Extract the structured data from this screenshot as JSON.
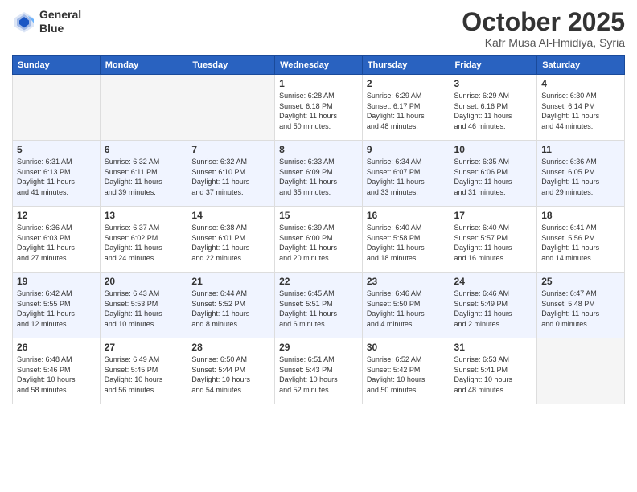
{
  "header": {
    "logo_line1": "General",
    "logo_line2": "Blue",
    "month": "October 2025",
    "location": "Kafr Musa Al-Hmidiya, Syria"
  },
  "days_of_week": [
    "Sunday",
    "Monday",
    "Tuesday",
    "Wednesday",
    "Thursday",
    "Friday",
    "Saturday"
  ],
  "weeks": [
    [
      {
        "day": "",
        "info": ""
      },
      {
        "day": "",
        "info": ""
      },
      {
        "day": "",
        "info": ""
      },
      {
        "day": "1",
        "info": "Sunrise: 6:28 AM\nSunset: 6:18 PM\nDaylight: 11 hours\nand 50 minutes."
      },
      {
        "day": "2",
        "info": "Sunrise: 6:29 AM\nSunset: 6:17 PM\nDaylight: 11 hours\nand 48 minutes."
      },
      {
        "day": "3",
        "info": "Sunrise: 6:29 AM\nSunset: 6:16 PM\nDaylight: 11 hours\nand 46 minutes."
      },
      {
        "day": "4",
        "info": "Sunrise: 6:30 AM\nSunset: 6:14 PM\nDaylight: 11 hours\nand 44 minutes."
      }
    ],
    [
      {
        "day": "5",
        "info": "Sunrise: 6:31 AM\nSunset: 6:13 PM\nDaylight: 11 hours\nand 41 minutes."
      },
      {
        "day": "6",
        "info": "Sunrise: 6:32 AM\nSunset: 6:11 PM\nDaylight: 11 hours\nand 39 minutes."
      },
      {
        "day": "7",
        "info": "Sunrise: 6:32 AM\nSunset: 6:10 PM\nDaylight: 11 hours\nand 37 minutes."
      },
      {
        "day": "8",
        "info": "Sunrise: 6:33 AM\nSunset: 6:09 PM\nDaylight: 11 hours\nand 35 minutes."
      },
      {
        "day": "9",
        "info": "Sunrise: 6:34 AM\nSunset: 6:07 PM\nDaylight: 11 hours\nand 33 minutes."
      },
      {
        "day": "10",
        "info": "Sunrise: 6:35 AM\nSunset: 6:06 PM\nDaylight: 11 hours\nand 31 minutes."
      },
      {
        "day": "11",
        "info": "Sunrise: 6:36 AM\nSunset: 6:05 PM\nDaylight: 11 hours\nand 29 minutes."
      }
    ],
    [
      {
        "day": "12",
        "info": "Sunrise: 6:36 AM\nSunset: 6:03 PM\nDaylight: 11 hours\nand 27 minutes."
      },
      {
        "day": "13",
        "info": "Sunrise: 6:37 AM\nSunset: 6:02 PM\nDaylight: 11 hours\nand 24 minutes."
      },
      {
        "day": "14",
        "info": "Sunrise: 6:38 AM\nSunset: 6:01 PM\nDaylight: 11 hours\nand 22 minutes."
      },
      {
        "day": "15",
        "info": "Sunrise: 6:39 AM\nSunset: 6:00 PM\nDaylight: 11 hours\nand 20 minutes."
      },
      {
        "day": "16",
        "info": "Sunrise: 6:40 AM\nSunset: 5:58 PM\nDaylight: 11 hours\nand 18 minutes."
      },
      {
        "day": "17",
        "info": "Sunrise: 6:40 AM\nSunset: 5:57 PM\nDaylight: 11 hours\nand 16 minutes."
      },
      {
        "day": "18",
        "info": "Sunrise: 6:41 AM\nSunset: 5:56 PM\nDaylight: 11 hours\nand 14 minutes."
      }
    ],
    [
      {
        "day": "19",
        "info": "Sunrise: 6:42 AM\nSunset: 5:55 PM\nDaylight: 11 hours\nand 12 minutes."
      },
      {
        "day": "20",
        "info": "Sunrise: 6:43 AM\nSunset: 5:53 PM\nDaylight: 11 hours\nand 10 minutes."
      },
      {
        "day": "21",
        "info": "Sunrise: 6:44 AM\nSunset: 5:52 PM\nDaylight: 11 hours\nand 8 minutes."
      },
      {
        "day": "22",
        "info": "Sunrise: 6:45 AM\nSunset: 5:51 PM\nDaylight: 11 hours\nand 6 minutes."
      },
      {
        "day": "23",
        "info": "Sunrise: 6:46 AM\nSunset: 5:50 PM\nDaylight: 11 hours\nand 4 minutes."
      },
      {
        "day": "24",
        "info": "Sunrise: 6:46 AM\nSunset: 5:49 PM\nDaylight: 11 hours\nand 2 minutes."
      },
      {
        "day": "25",
        "info": "Sunrise: 6:47 AM\nSunset: 5:48 PM\nDaylight: 11 hours\nand 0 minutes."
      }
    ],
    [
      {
        "day": "26",
        "info": "Sunrise: 6:48 AM\nSunset: 5:46 PM\nDaylight: 10 hours\nand 58 minutes."
      },
      {
        "day": "27",
        "info": "Sunrise: 6:49 AM\nSunset: 5:45 PM\nDaylight: 10 hours\nand 56 minutes."
      },
      {
        "day": "28",
        "info": "Sunrise: 6:50 AM\nSunset: 5:44 PM\nDaylight: 10 hours\nand 54 minutes."
      },
      {
        "day": "29",
        "info": "Sunrise: 6:51 AM\nSunset: 5:43 PM\nDaylight: 10 hours\nand 52 minutes."
      },
      {
        "day": "30",
        "info": "Sunrise: 6:52 AM\nSunset: 5:42 PM\nDaylight: 10 hours\nand 50 minutes."
      },
      {
        "day": "31",
        "info": "Sunrise: 6:53 AM\nSunset: 5:41 PM\nDaylight: 10 hours\nand 48 minutes."
      },
      {
        "day": "",
        "info": ""
      }
    ]
  ]
}
